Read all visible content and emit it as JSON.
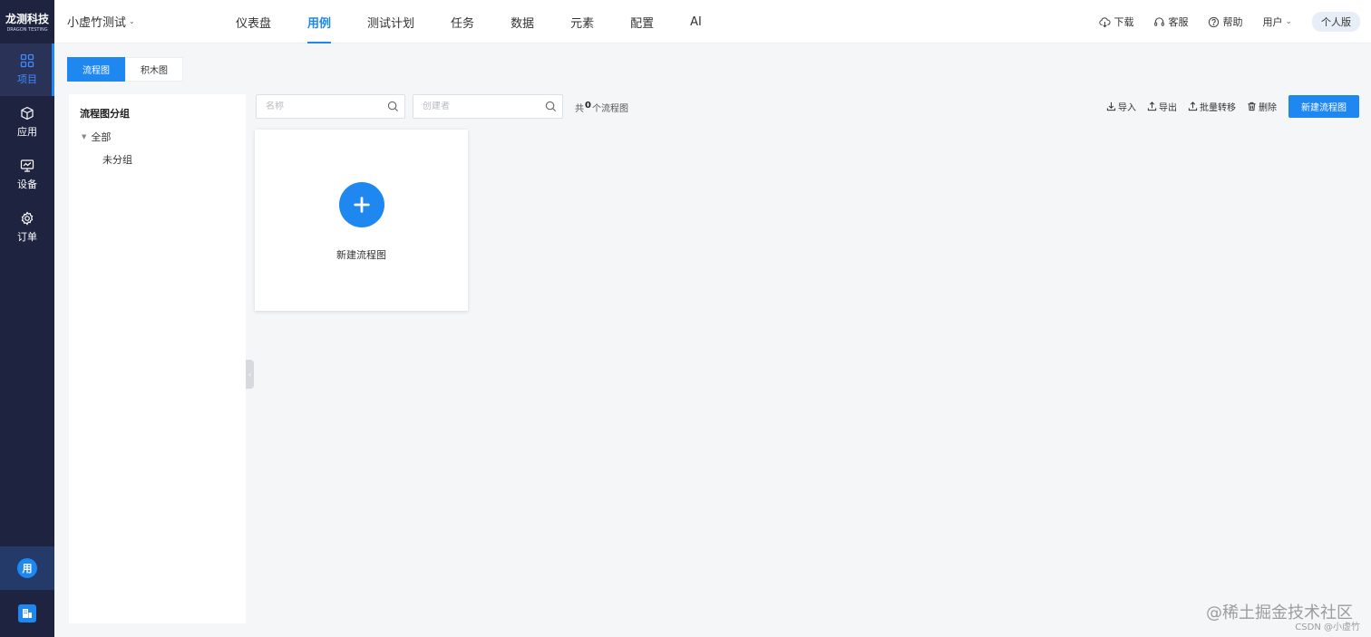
{
  "brand": {
    "name_cn": "龙测科技",
    "name_en": "DRAGON TESTING"
  },
  "sidebar": {
    "items": [
      {
        "label": "项目",
        "icon": "grid-icon"
      },
      {
        "label": "应用",
        "icon": "box-icon"
      },
      {
        "label": "设备",
        "icon": "monitor-icon"
      },
      {
        "label": "订单",
        "icon": "gear-icon"
      }
    ],
    "user_avatar": "用"
  },
  "header": {
    "project": "小虚竹测试",
    "tabs": [
      "仪表盘",
      "用例",
      "测试计划",
      "任务",
      "数据",
      "元素",
      "配置",
      "AI"
    ],
    "active_tab": "用例",
    "links": {
      "download": "下载",
      "service": "客服",
      "help": "帮助",
      "user": "用户"
    },
    "edition": "个人版"
  },
  "view_toggle": {
    "flow": "流程图",
    "blocks": "积木图"
  },
  "groups": {
    "title": "流程图分组",
    "all": "全部",
    "ungrouped": "未分组"
  },
  "search": {
    "name_placeholder": "名称",
    "creator_placeholder": "创建者"
  },
  "count": {
    "prefix": "共",
    "value": "0",
    "suffix": "个流程图"
  },
  "toolbar": {
    "import": "导入",
    "export": "导出",
    "batch_move": "批量转移",
    "delete": "删除",
    "new_flow": "新建流程图"
  },
  "card": {
    "label": "新建流程图"
  },
  "watermark": {
    "line1": "@稀土掘金技术社区",
    "line2": "CSDN @小虚竹"
  },
  "colors": {
    "primary": "#1e87f0",
    "sidebar_bg": "#1e2440"
  }
}
